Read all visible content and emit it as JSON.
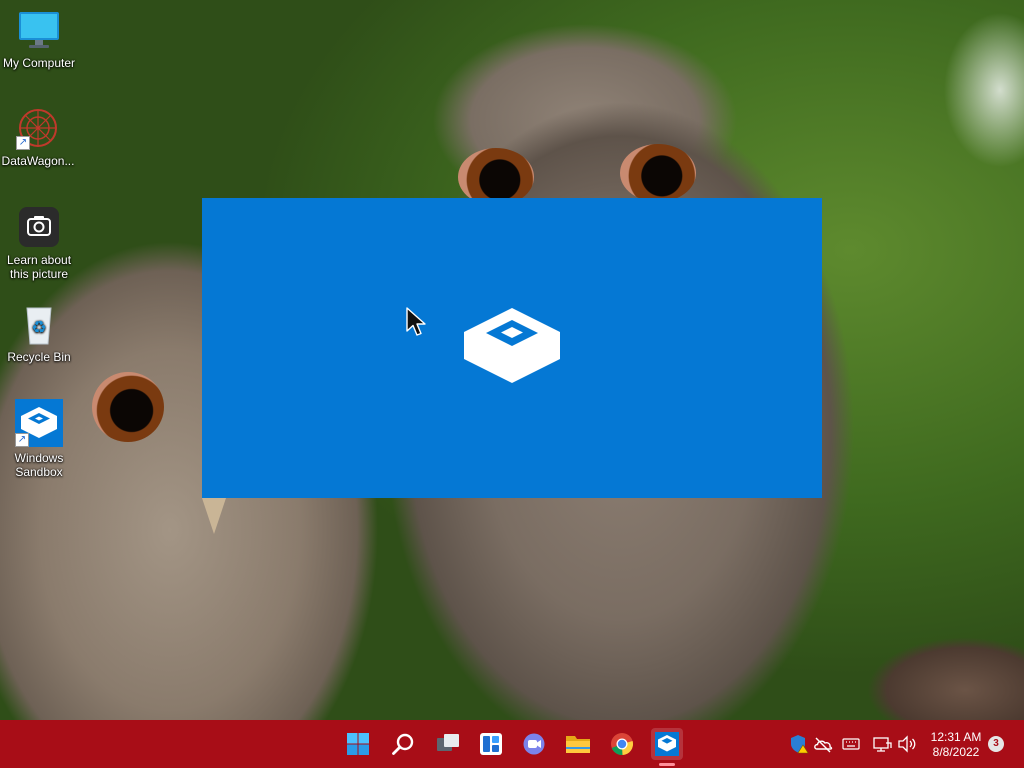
{
  "desktop": {
    "icons": [
      {
        "id": "my-computer",
        "label": "My Computer"
      },
      {
        "id": "datawagon",
        "label": "DataWagon..."
      },
      {
        "id": "learn-about-this-picture",
        "label": "Learn about this picture"
      },
      {
        "id": "recycle-bin",
        "label": "Recycle Bin"
      },
      {
        "id": "windows-sandbox",
        "label": "Windows Sandbox"
      }
    ]
  },
  "splash": {
    "app": "Windows Sandbox",
    "accent": "#0578d4"
  },
  "taskbar": {
    "color": "#a80d17",
    "buttons": [
      {
        "id": "start",
        "icon": "windows-logo-icon"
      },
      {
        "id": "search",
        "icon": "search-icon"
      },
      {
        "id": "task-view",
        "icon": "task-view-icon"
      },
      {
        "id": "widgets",
        "icon": "widgets-icon"
      },
      {
        "id": "chat",
        "icon": "chat-icon"
      },
      {
        "id": "file-explorer",
        "icon": "folder-icon"
      },
      {
        "id": "chrome",
        "icon": "chrome-icon"
      },
      {
        "id": "windows-sandbox",
        "icon": "sandbox-icon",
        "active": true
      }
    ],
    "tray": {
      "icons": [
        "security-warning-icon",
        "onedrive-icon",
        "keyboard-icon",
        "network-icon",
        "volume-icon"
      ],
      "time": "12:31 AM",
      "date": "8/8/2022",
      "notification_count": "3"
    }
  }
}
